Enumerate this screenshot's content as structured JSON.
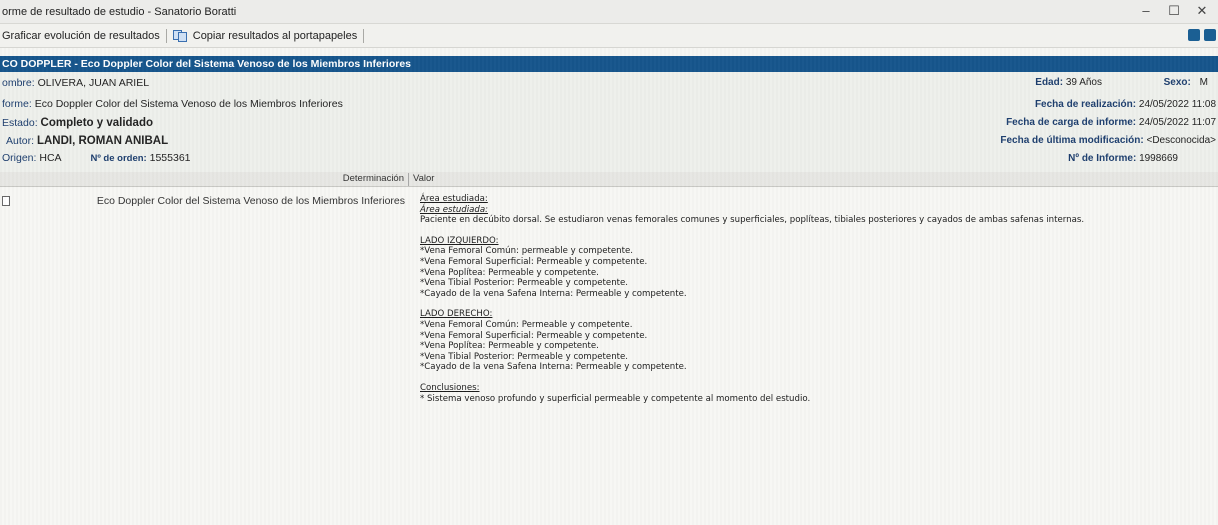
{
  "window": {
    "title": "orme de resultado de estudio - Sanatorio Boratti",
    "minimize": "–",
    "maximize": "☐",
    "close": "✕"
  },
  "toolbar": {
    "graph_label": "Graficar evolución de resultados",
    "copy_label": "Copiar resultados al portapapeles",
    "copy_icon": "copy-icon"
  },
  "study": {
    "title": "CO DOPPLER - Eco Doppler Color del Sistema Venoso de los Miembros Inferiores"
  },
  "patient": {
    "name_label": "ombre:",
    "name": "OLIVERA, JUAN ARIEL",
    "report_label": "forme:",
    "report": "Eco Doppler Color del Sistema Venoso de los Miembros Inferiores",
    "status_label": "Estado:",
    "status": "Completo y validado",
    "author_label": "Autor:",
    "author": "LANDI, ROMAN ANIBAL",
    "origin_label": "Origen:",
    "origin": "HCA",
    "order_label": "Nº de orden:",
    "order": "1555361",
    "age_label": "Edad:",
    "age": "39 Años",
    "sex_label": "Sexo:",
    "sex": "M",
    "realization_label": "Fecha de realización:",
    "realization": "24/05/2022 11:08",
    "upload_label": "Fecha de carga de informe:",
    "upload": "24/05/2022 11:07",
    "modified_label": "Fecha de última modificación:",
    "modified": "<Desconocida>",
    "report_no_label": "Nº de Informe:",
    "report_no": "1998669"
  },
  "columns": {
    "determination": "Determinación",
    "value": "Valor"
  },
  "row": {
    "determination": "Eco Doppler Color del Sistema Venoso de los Miembros Inferiores",
    "area_heading": "Área estudiada:",
    "area_heading_italic": "Área estudiada:",
    "area_text": "Paciente en decúbito dorsal. Se estudiaron venas femorales comunes y superficiales, poplíteas, tibiales posteriores y cayados de ambas safenas internas.",
    "left_heading": "LADO IZQUIERDO:",
    "left": [
      "*Vena Femoral Común: permeable y competente.",
      "*Vena Femoral Superficial: Permeable y competente.",
      "*Vena Poplítea: Permeable y competente.",
      "*Vena Tibial Posterior: Permeable y competente.",
      "*Cayado de la vena Safena Interna: Permeable y competente."
    ],
    "right_heading": "LADO DERECHO:",
    "right": [
      "*Vena Femoral Común: Permeable y competente.",
      "*Vena Femoral Superficial: Permeable y competente.",
      "*Vena Poplítea: Permeable y competente.",
      "*Vena Tibial Posterior: Permeable y competente.",
      "*Cayado de la vena Safena Interna: Permeable y competente."
    ],
    "conclusions_heading": "Conclusiones:",
    "conclusion": "* Sistema venoso profundo y superficial permeable y competente al momento del estudio."
  },
  "colors": {
    "header_blue": "#16558c",
    "label_blue": "#1d3e6e"
  }
}
